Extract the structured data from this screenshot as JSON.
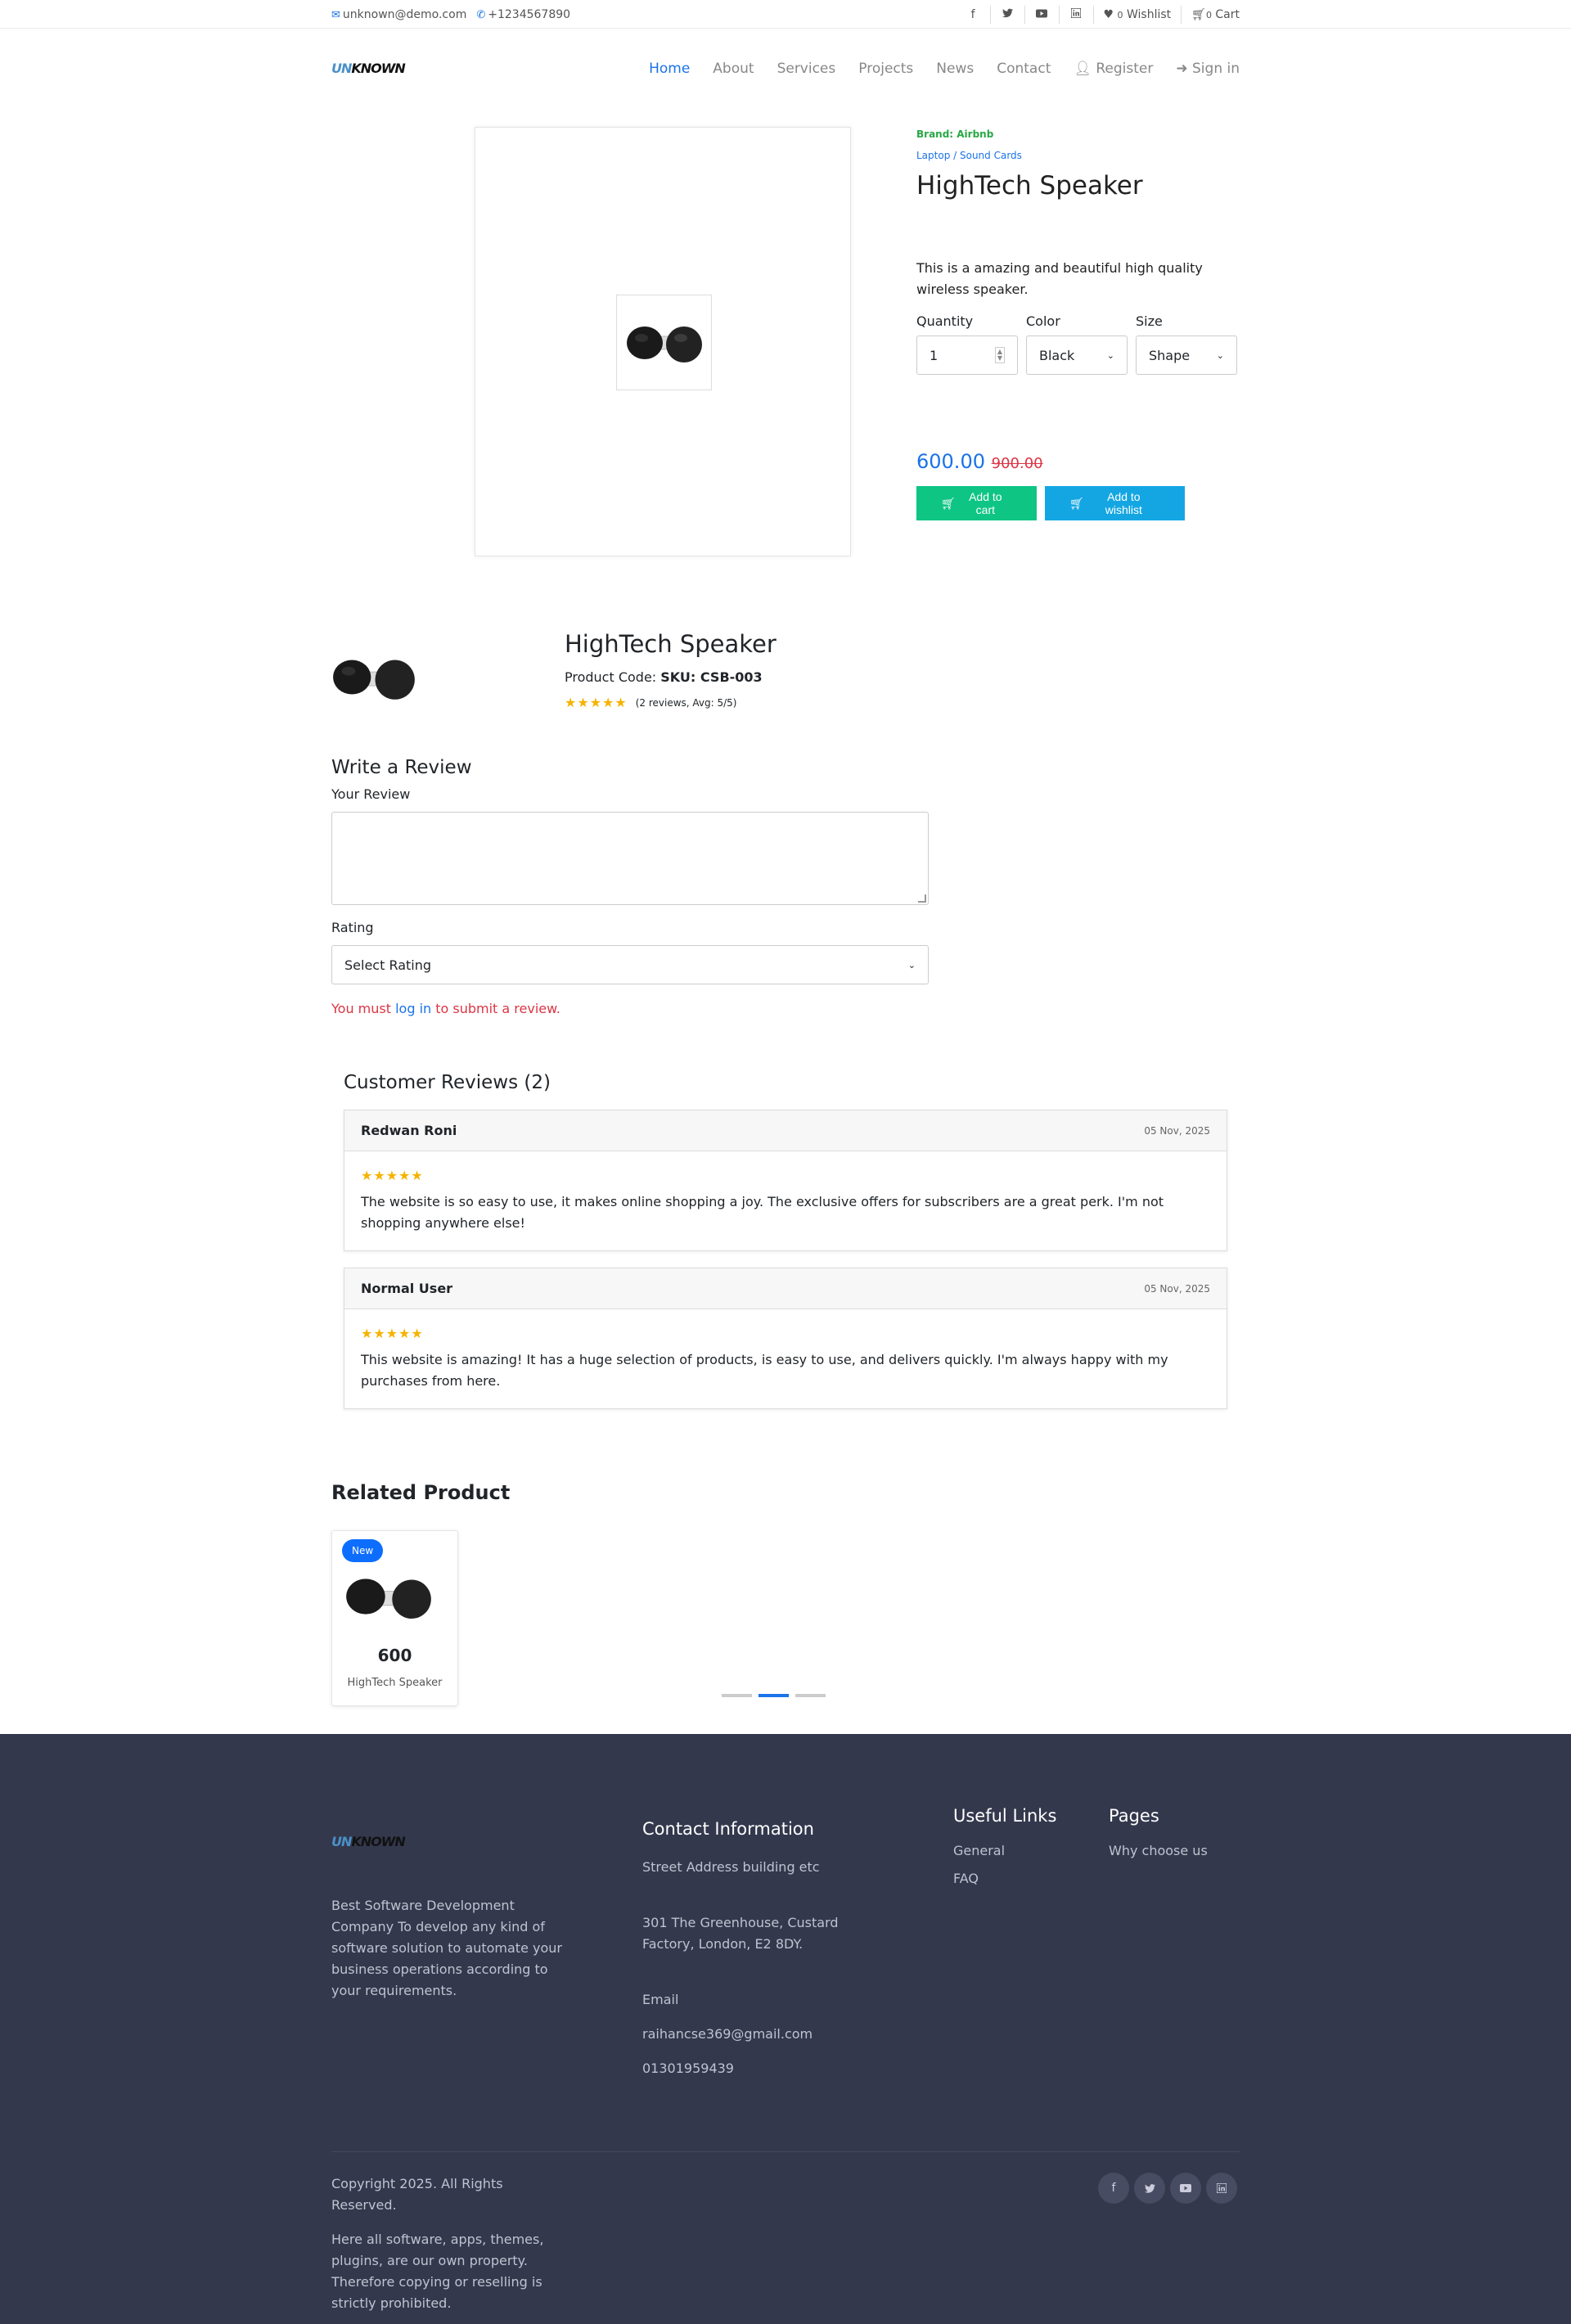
{
  "topbar": {
    "email": "unknown@demo.com",
    "phone": "+1234567890",
    "social": [
      "f",
      "t",
      "yt",
      "in"
    ],
    "wishlist_count": "0",
    "wishlist_label": "Wishlist",
    "cart_count": "0",
    "cart_label": "Cart"
  },
  "logo": {
    "part1": "UN",
    "part2": "KNOWN"
  },
  "nav": {
    "items": [
      "Home",
      "About",
      "Services",
      "Projects",
      "News",
      "Contact"
    ],
    "register": "Register",
    "signin": "Sign in",
    "active": "Home"
  },
  "product": {
    "brand": "Brand: Airbnb",
    "breadcrumb": "Laptop / Sound Cards",
    "title": "HighTech Speaker",
    "description": "This is a amazing and beautiful high quality wireless speaker.",
    "quantity_label": "Quantity",
    "quantity_value": "1",
    "color_label": "Color",
    "color_value": "Black",
    "size_label": "Size",
    "size_value": "Shape",
    "price": "600.00",
    "old_price": "900.00",
    "add_to_cart": "Add to cart",
    "add_to_wishlist": "Add to wishlist"
  },
  "detail": {
    "title": "HighTech Speaker",
    "code_label": "Product Code: ",
    "code_value": "SKU: CSB-003",
    "stars": "★★★★★",
    "rating_text": "(2 reviews, Avg: 5/5)"
  },
  "review_form": {
    "title": "Write a Review",
    "review_label": "Your Review",
    "rating_label": "Rating",
    "rating_placeholder": "Select Rating",
    "must_pre": "You must ",
    "must_link": "log in",
    "must_post": " to submit a review."
  },
  "reviews": {
    "title": "Customer Reviews (2)",
    "items": [
      {
        "name": "Redwan Roni",
        "date": "05 Nov, 2025",
        "stars": "★★★★★",
        "text": "The website is so easy to use, it makes online shopping a joy. The exclusive offers for subscribers are a great perk. I'm not shopping anywhere else!"
      },
      {
        "name": "Normal User",
        "date": "05 Nov, 2025",
        "stars": "★★★★★",
        "text": "This website is amazing! It has a huge selection of products, is easy to use, and delivers quickly. I'm always happy with my purchases from here."
      }
    ]
  },
  "related": {
    "title": "Related Product",
    "badge": "New",
    "price": "600",
    "name": "HighTech Speaker"
  },
  "footer": {
    "about": "Best Software Development Company To develop any kind of software solution to automate your business operations according to your requirements.",
    "contact_title": "Contact Information",
    "street_label": "Street Address building etc",
    "address": "301 The Greenhouse, Custard Factory, London, E2 8DY.",
    "email_label": "Email",
    "email": "raihancse369@gmail.com",
    "phone": "01301959439",
    "useful_title": "Useful Links",
    "useful_links": [
      "General",
      "FAQ"
    ],
    "pages_title": "Pages",
    "pages_links": [
      "Why choose us"
    ],
    "copyright": "Copyright 2025. All Rights Reserved.",
    "disclaimer": "Here all software, apps, themes, plugins, are our own property. Therefore copying or reselling is strictly prohibited."
  }
}
